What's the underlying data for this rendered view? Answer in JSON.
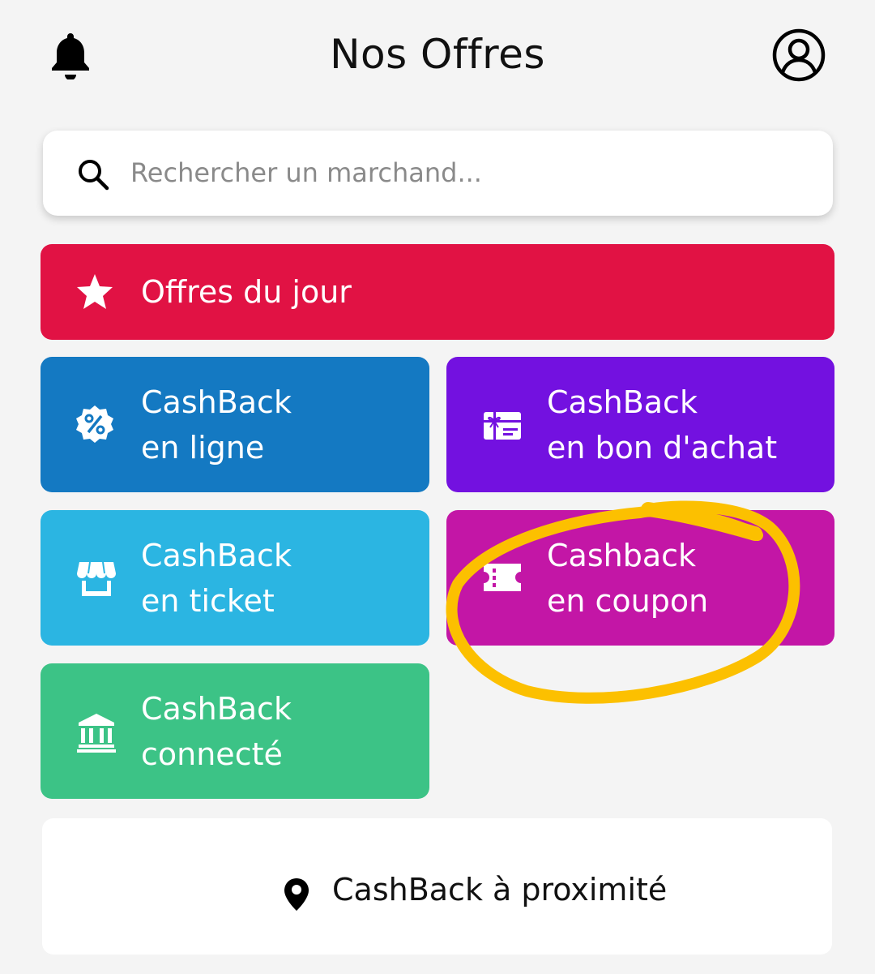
{
  "header": {
    "title": "Nos Offres",
    "left_icon": "bell-icon",
    "right_icon": "user-avatar-icon"
  },
  "search": {
    "placeholder": "Rechercher un marchand...",
    "value": "",
    "icon": "search-icon"
  },
  "tiles": [
    {
      "id": "offres-du-jour",
      "line1": "Offres du jour",
      "line2": "",
      "icon": "star-icon",
      "color": "#e11244"
    },
    {
      "id": "cashback-en-ligne",
      "line1": "CashBack",
      "line2": "en ligne",
      "icon": "percent-badge-icon",
      "color": "#1479c2"
    },
    {
      "id": "cashback-bon-achat",
      "line1": "CashBack",
      "line2": "en bon d'achat",
      "icon": "gift-card-icon",
      "color": "#7311e0"
    },
    {
      "id": "cashback-ticket",
      "line1": "CashBack",
      "line2": "en ticket",
      "icon": "store-icon",
      "color": "#2bb5e2"
    },
    {
      "id": "cashback-coupon",
      "line1": "Cashback",
      "line2": "en coupon",
      "icon": "ticket-icon",
      "color": "#c316a6"
    },
    {
      "id": "cashback-connecte",
      "line1": "CashBack",
      "line2": "connecté",
      "icon": "bank-icon",
      "color": "#3cc386"
    }
  ],
  "nearby": {
    "label": "CashBack à proximité",
    "icon": "map-pin-icon"
  },
  "annotation": {
    "type": "hand-drawn circle",
    "target": "cashback-coupon",
    "color": "#fcc000"
  }
}
